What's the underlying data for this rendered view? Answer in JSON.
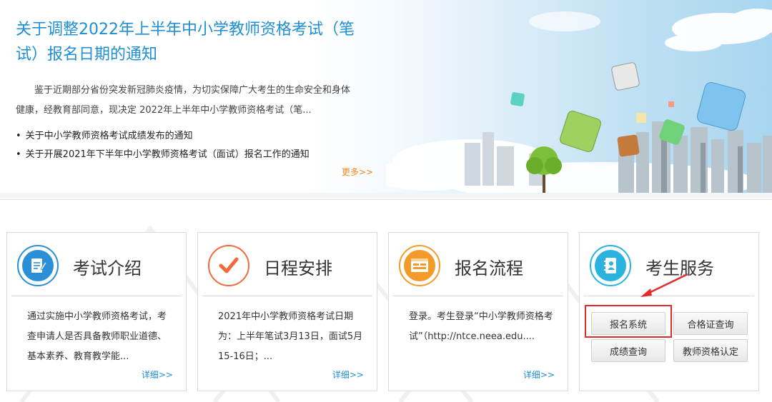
{
  "banner": {
    "headline": "关于调整2022年上半年中小学教师资格考试（笔试）报名日期的通知",
    "summary": "鉴于近期部分省份突发新冠肺炎疫情，为切实保障广大考生的生命安全和身体健康，经教育部同意，现决定 2022年上半年中小学教师资格考试（笔...",
    "links": [
      "关于中小学教师资格考试成绩发布的通知",
      "关于开展2021年下半年中小学教师资格考试（面试）报名工作的通知"
    ],
    "more_label": "更多>>"
  },
  "cards": [
    {
      "title": "考试介绍",
      "body": "通过实施中小学教师资格考试，考查申请人是否具备教师职业道德、基本素养、教育教学能...",
      "detail": "详细>>",
      "icon": "document-edit-icon",
      "color": "#2b8fd8"
    },
    {
      "title": "日程安排",
      "body": "2021年中小学教师资格考试日期为：上半年笔试3月13日，面试5月15-16日；...",
      "detail": "详细>>",
      "icon": "checkmark-icon",
      "color": "#ef6a3a"
    },
    {
      "title": "报名流程",
      "body": "登录。考生登录“中小学教师资格考试”（http://ntce.neea.edu....",
      "detail": "详细>>",
      "icon": "browser-form-icon",
      "color": "#f39a2a"
    },
    {
      "title": "考生服务",
      "icon": "contact-book-icon",
      "color": "#2bb3e0"
    }
  ],
  "services": {
    "buttons": [
      "报名系统",
      "合格证查询",
      "成绩查询",
      "教师资格认定"
    ],
    "highlighted": "报名系统"
  },
  "colors": {
    "accent": "#1e8fd3",
    "more": "#f08a1d",
    "highlight": "#e22b2b"
  }
}
